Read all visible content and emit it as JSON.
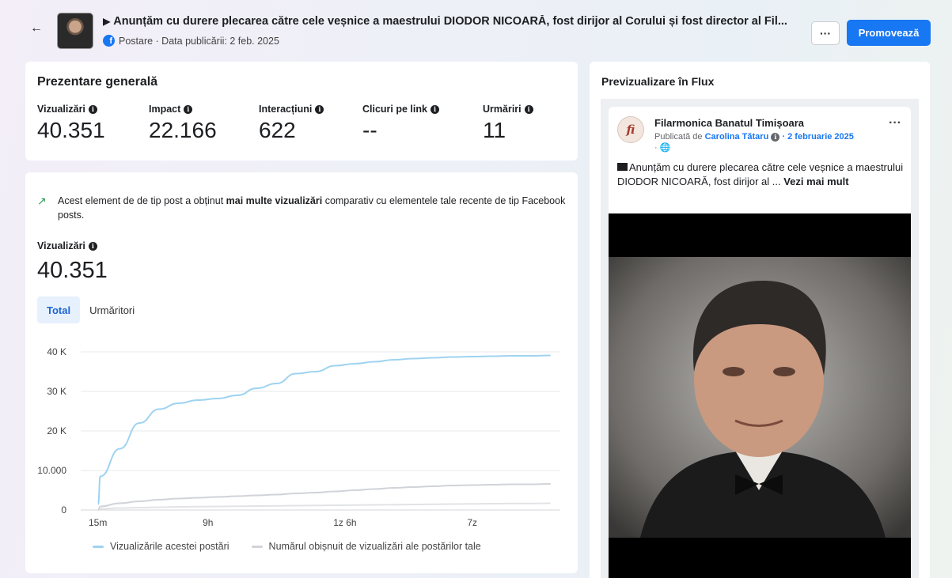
{
  "header": {
    "flag": "▶",
    "title": "Anunțăm cu durere plecarea către cele veșnice a maestrului DIODOR NICOARĂ, fost dirijor al Corului și fost director al Fil...",
    "subtitle": "Postare · Data publicării: 2 feb. 2025",
    "more_label": "···",
    "promote_label": "Promovează"
  },
  "overview": {
    "title": "Prezentare generală",
    "metrics": [
      {
        "label": "Vizualizări",
        "value": "40.351"
      },
      {
        "label": "Impact",
        "value": "22.166"
      },
      {
        "label": "Interacțiuni",
        "value": "622"
      },
      {
        "label": "Clicuri pe link",
        "value": "--"
      },
      {
        "label": "Urmăriri",
        "value": "11"
      }
    ]
  },
  "insight": {
    "prefix": "Acest element de de tip post a obținut ",
    "bold": "mai multe vizualizări",
    "suffix": " comparativ cu elementele tale recente de tip Facebook posts."
  },
  "views": {
    "label": "Vizualizări",
    "value": "40.351"
  },
  "tabs": [
    {
      "label": "Total",
      "active": true
    },
    {
      "label": "Urmăritori",
      "active": false
    }
  ],
  "chart_data": {
    "type": "line",
    "y_tick_labels": [
      "0",
      "10.000",
      "20 K",
      "30 K",
      "40 K"
    ],
    "y_ticks": [
      0,
      10000,
      20000,
      30000,
      40000
    ],
    "ylim": [
      0,
      40000
    ],
    "x_tick_labels": [
      "15m",
      "9h",
      "1z 6h",
      "7z"
    ],
    "x": [
      0,
      1,
      2,
      3,
      4,
      5,
      6,
      7,
      8,
      9,
      10,
      11,
      12,
      13,
      14,
      15,
      16,
      17,
      18,
      19,
      20,
      21,
      22,
      23,
      24
    ],
    "x_tick_positions": [
      0,
      6.5,
      13.5,
      20
    ],
    "xlim": [
      0,
      24.5
    ],
    "series": [
      {
        "name": "Vizualizările acestei postări",
        "color": "#9fd3f0",
        "values": [
          1500,
          8500,
          15500,
          22000,
          25500,
          27000,
          27800,
          28200,
          29000,
          30800,
          32000,
          34500,
          35000,
          36500,
          37000,
          37500,
          38000,
          38300,
          38500,
          38700,
          38800,
          38900,
          39000,
          39000,
          39100
        ]
      },
      {
        "name": "Numărul obișnuit de vizualizări ale postărilor tale",
        "color": "#d0d3d8",
        "values": [
          0,
          900,
          1700,
          2200,
          2600,
          2900,
          3100,
          3300,
          3500,
          3700,
          3900,
          4200,
          4400,
          4700,
          5000,
          5300,
          5600,
          5800,
          6000,
          6200,
          6300,
          6400,
          6500,
          6500,
          6600
        ]
      },
      {
        "name": "",
        "color": "#e1e3e6",
        "values": [
          0,
          300,
          500,
          600,
          700,
          800,
          850,
          900,
          950,
          1000,
          1050,
          1100,
          1150,
          1200,
          1250,
          1300,
          1350,
          1400,
          1450,
          1500,
          1550,
          1600,
          1650,
          1650,
          1700
        ]
      }
    ]
  },
  "preview": {
    "title": "Previzualizare în Flux",
    "page_name": "Filarmonica Banatul Timișoara",
    "published_by": "Publicată de ",
    "author": "Carolina Tătaru",
    "date": " · 2 februarie 2025",
    "globe": "· 🌐",
    "avatar_text": "fi",
    "post_more": "···",
    "post_text": "Anunțăm cu durere plecarea către cele veșnice a maestrului DIODOR NICOARĂ, fost dirijor al ...",
    "see_more": "Vezi mai mult"
  },
  "colors": {
    "accent": "#1877f2",
    "trend": "#2e9e57"
  }
}
